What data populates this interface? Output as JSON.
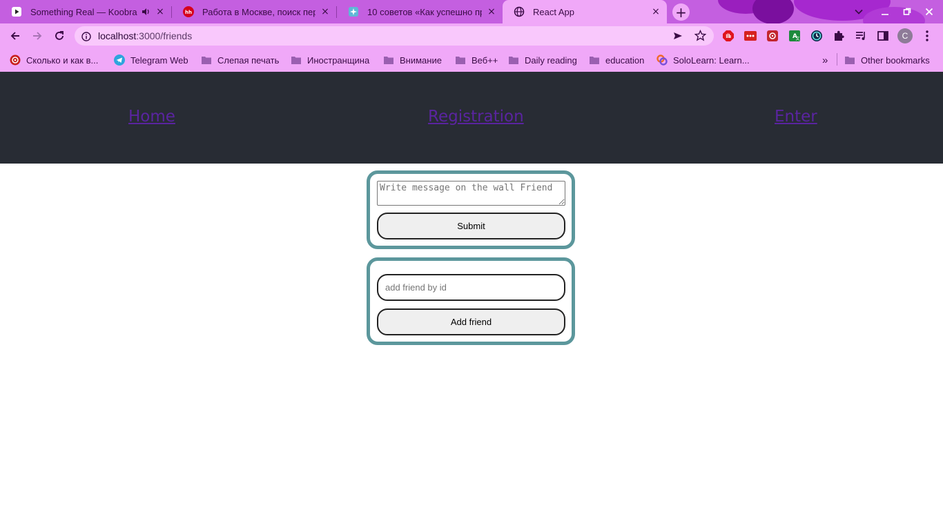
{
  "tabs": [
    {
      "title": "Something Real — Koobra",
      "favicon": "youtube-music-icon",
      "close": "×"
    },
    {
      "title": "Работа в Москве, поиск персонала",
      "favicon": "hh-icon",
      "close": "×"
    },
    {
      "title": "10 советов «Как успешно пройти",
      "favicon": "spark-icon",
      "close": "×"
    },
    {
      "title": "React App",
      "favicon": "globe-icon",
      "close": "×"
    }
  ],
  "newtab_label": "+",
  "address": {
    "host": "localhost",
    "path": ":3000/friends"
  },
  "bookmarks": [
    {
      "label": "Сколько и как в...",
      "icon": "site-icon"
    },
    {
      "label": "Telegram Web",
      "icon": "telegram-icon"
    },
    {
      "label": "Слепая печать",
      "icon": "folder-icon"
    },
    {
      "label": "Иностранщина",
      "icon": "folder-icon"
    },
    {
      "label": "Внимание",
      "icon": "folder-icon"
    },
    {
      "label": "Веб++",
      "icon": "folder-icon"
    },
    {
      "label": "Daily reading",
      "icon": "folder-icon"
    },
    {
      "label": "education",
      "icon": "folder-icon"
    },
    {
      "label": "SoloLearn: Learn...",
      "icon": "sololearn-icon"
    }
  ],
  "bookmarks_more": "»",
  "other_bookmarks": "Other bookmarks",
  "profile_initial": "C",
  "nav": {
    "home": "Home",
    "registration": "Registration",
    "enter": "Enter"
  },
  "wall": {
    "placeholder": "Write message on the wall Friend",
    "submit": "Submit"
  },
  "friend": {
    "placeholder": "add friend by id",
    "add": "Add friend"
  },
  "colors": {
    "tabstrip": "#c45fe0",
    "toolbar": "#f0a8f8",
    "header": "#282c34",
    "link": "#5a24a0",
    "card_border": "#5c979c"
  }
}
